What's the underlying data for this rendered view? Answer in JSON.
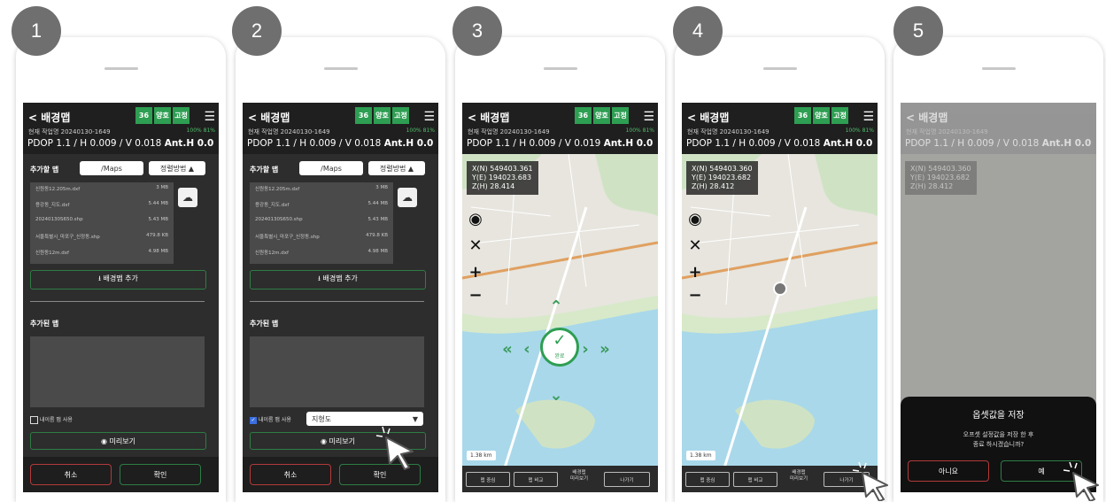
{
  "steps": [
    "1",
    "2",
    "3",
    "4",
    "5"
  ],
  "app": {
    "title": "< 배경맵",
    "status_badges": [
      "36",
      "양호",
      "고정"
    ],
    "menu_icon": "hamburger-icon",
    "job_label": "현재 작업명 20240130-1649",
    "battery": "100% 81%",
    "pdop_a": "PDOP 1.1 / H 0.009 / V 0.018",
    "pdop_b": "PDOP 1.1 / H 0.009 / V 0.019",
    "ant_h": "Ant.H 0.0"
  },
  "form": {
    "add_map_label": "추가할 맵",
    "path": "/Maps",
    "sort_button": "정렬방법 ▲",
    "files": [
      {
        "name": "신원동12.205m.dxf",
        "size": "3 MB"
      },
      {
        "name": "용강동_지도.dxf",
        "size": "5.44 MB"
      },
      {
        "name": "20240130S650.shp",
        "size": "5.43 MB"
      },
      {
        "name": "서울특별시_마포구_신정동.shp",
        "size": "479.8 KB"
      },
      {
        "name": "신원동12m.dxf",
        "size": "4.98 MB"
      }
    ],
    "add_button": "⭳ 배경맵 추가",
    "added_label": "추가된 맵",
    "custom_map_checkbox": "내이름 맵 사용",
    "select_value": "지형도",
    "preview_button": "◉ 미리보기",
    "cancel_button": "취소",
    "ok_button": "확인"
  },
  "map": {
    "coord_a": [
      "X(N) 549403.361",
      "Y(E) 194023.683",
      "Z(H) 28.414"
    ],
    "coord_b": [
      "X(N) 549403.360",
      "Y(E) 194023.682",
      "Z(H) 28.412"
    ],
    "scale": "1.38 km",
    "complete_label": "완료",
    "bar_buttons": [
      "맵 중심",
      "맵 비교"
    ],
    "bar_text": "배경맵\n미리보기",
    "exit_button": "나가기"
  },
  "dialog": {
    "title": "옵셋값을 저장",
    "message": "오프셋 설정값을 저장 한 후\n종료 하시겠습니까?",
    "no_button": "아니요",
    "yes_button": "예"
  },
  "colors": {
    "accent_green": "#2e9e52",
    "danger_red": "#b33a3a",
    "water": "#a9d8ea"
  }
}
